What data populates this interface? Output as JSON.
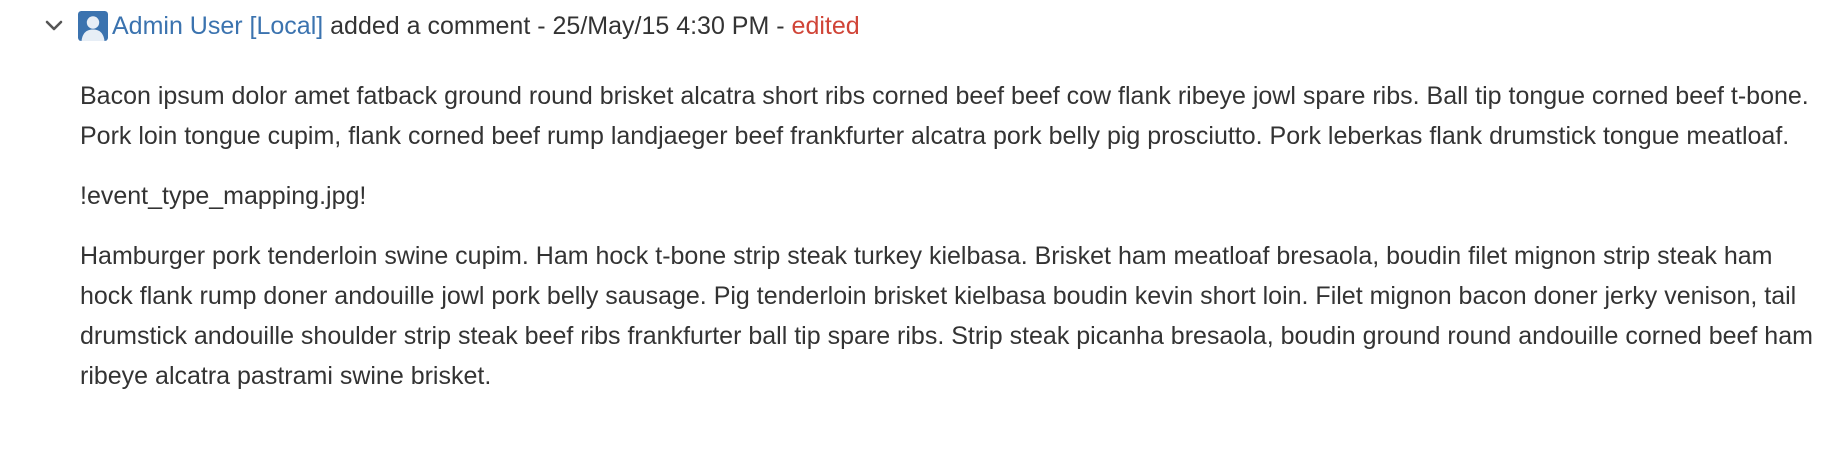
{
  "comment": {
    "author": "Admin User [Local]",
    "action": "added a comment",
    "separator": "-",
    "timestamp": "25/May/15 4:30 PM",
    "edited_label": "edited",
    "paragraphs": [
      "Bacon ipsum dolor amet fatback ground round brisket alcatra short ribs corned beef beef cow flank ribeye jowl spare ribs. Ball tip tongue corned beef t-bone. Pork loin tongue cupim, flank corned beef rump landjaeger beef frankfurter alcatra pork belly pig prosciutto. Pork leberkas flank drumstick tongue meatloaf.",
      "!event_type_mapping.jpg!",
      "Hamburger pork tenderloin swine cupim. Ham hock t-bone strip steak turkey kielbasa. Brisket ham meatloaf bresaola, boudin filet mignon strip steak ham hock flank rump doner andouille jowl pork belly sausage. Pig tenderloin brisket kielbasa boudin kevin short loin. Filet mignon bacon doner jerky venison, tail drumstick andouille shoulder strip steak beef ribs frankfurter ball tip spare ribs. Strip steak picanha bresaola, boudin ground round andouille corned beef ham ribeye alcatra pastrami swine brisket."
    ]
  },
  "icons": {
    "collapse": "chevron-down-icon",
    "avatar": "user-avatar-icon"
  },
  "colors": {
    "link": "#3b73af",
    "edited": "#d04437",
    "text": "#333333",
    "avatar_bg": "#3b73af"
  }
}
